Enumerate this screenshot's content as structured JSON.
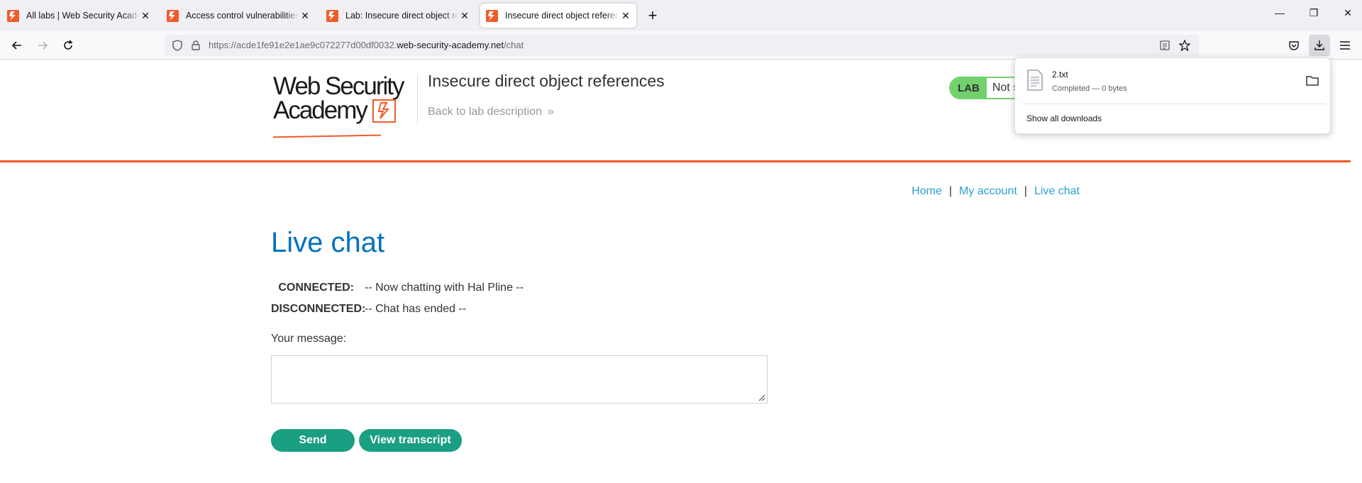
{
  "browser": {
    "tabs": [
      {
        "title": "All labs | Web Security Academy",
        "active": false
      },
      {
        "title": "Access control vulnerabilities and privilege escalation",
        "active": false
      },
      {
        "title": "Lab: Insecure direct object references",
        "active": false
      },
      {
        "title": "Insecure direct object references",
        "active": true
      }
    ],
    "url_prefix": "https://acde1fe91e2e1ae9c072277d00df0032.",
    "url_host": "web-security-academy.net",
    "url_path": "/chat"
  },
  "header": {
    "logo_line1": "Web Security",
    "logo_line2": "Academy",
    "lab_title": "Insecure direct object references",
    "back_link": "Back to lab description",
    "lab_badge": "LAB",
    "lab_status": "Not solved"
  },
  "nav": {
    "home": "Home",
    "sep1": "|",
    "my_account": "My account",
    "sep2": "|",
    "live_chat": "Live chat"
  },
  "chat": {
    "heading": "Live chat",
    "rows": [
      {
        "who": "CONNECTED:",
        "msg": "-- Now chatting with Hal Pline --"
      },
      {
        "who": "DISCONNECTED:",
        "msg": "-- Chat has ended --"
      }
    ],
    "message_label": "Your message:",
    "send_label": "Send",
    "transcript_label": "View transcript"
  },
  "downloads": {
    "file_name": "2.txt",
    "file_status": "Completed — 0 bytes",
    "show_all": "Show all downloads"
  },
  "colors": {
    "brand_orange": "#f15a29",
    "link_blue": "#29a1d1",
    "heading_blue": "#0071bc",
    "button_green": "#1a9f83",
    "lab_green": "#70d16d"
  }
}
